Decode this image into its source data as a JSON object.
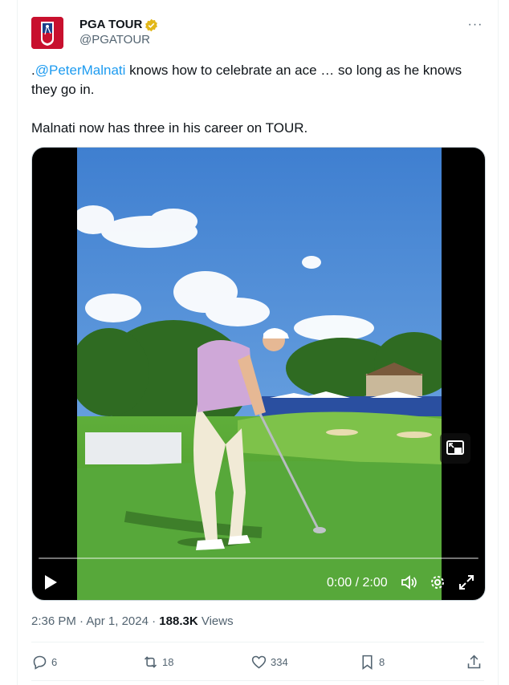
{
  "author": {
    "name": "PGA TOUR",
    "handle": "@PGATOUR",
    "avatar_icon": "pga-tour-logo",
    "verified_icon": "gold-verified-badge-icon"
  },
  "tweet": {
    "prefix": ".",
    "mention": "@PeterMalnati",
    "text_after_mention": " knows how to celebrate an ace … so long as he knows they go in.",
    "line2": "Malnati now has three in his career on TOUR."
  },
  "video": {
    "time_display": "0:00 / 2:00",
    "progress": 0,
    "controls": [
      "play-icon",
      "volume-icon",
      "settings-icon",
      "fullscreen-icon",
      "picture-in-picture-icon"
    ]
  },
  "meta": {
    "time": "2:36 PM",
    "sep1": "·",
    "date": "Apr 1, 2024",
    "sep2": "·",
    "views_count": "188.3K",
    "views_label": "Views"
  },
  "actions": {
    "replies": "6",
    "reposts": "18",
    "likes": "334",
    "bookmarks": "8"
  },
  "colors": {
    "link": "#1d9bf0",
    "secondary_text": "#536471",
    "brand_red": "#c8102e",
    "verified_gold": "#e2b719"
  }
}
